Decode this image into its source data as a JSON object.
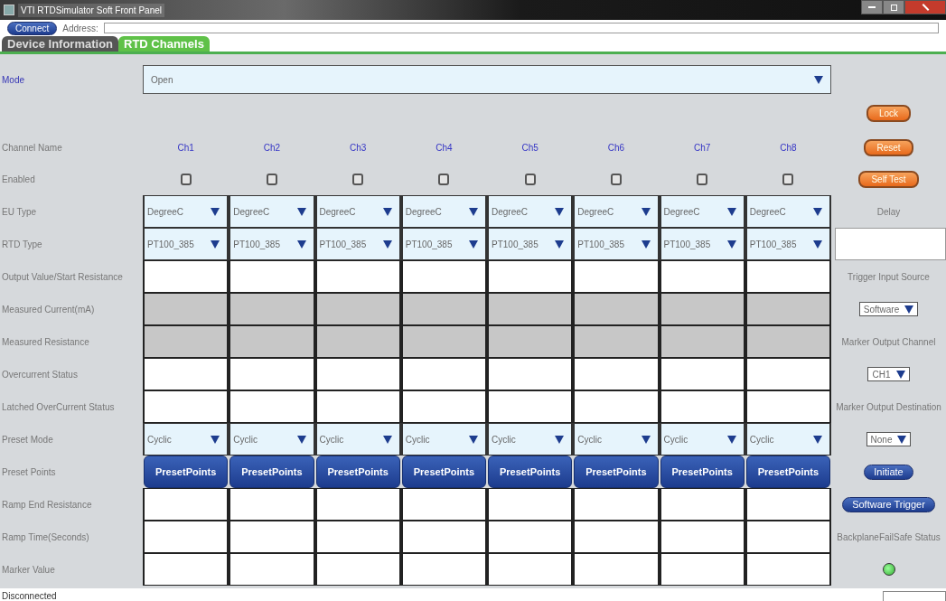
{
  "window": {
    "title": "VTI RTDSimulator Soft Front Panel"
  },
  "toolbar": {
    "connect_button": "Connect",
    "address_label": "Address:"
  },
  "tabs": [
    {
      "label": "Device Information",
      "selected": false
    },
    {
      "label": "RTD Channels",
      "selected": true
    }
  ],
  "mode": {
    "label": "Mode",
    "value": "Open"
  },
  "rows": [
    {
      "label": "Channel Name",
      "kind": "name",
      "cells": [
        "Ch1",
        "Ch2",
        "Ch3",
        "Ch4",
        "Ch5",
        "Ch6",
        "Ch7",
        "Ch8"
      ]
    },
    {
      "label": "Enabled",
      "kind": "checkbox",
      "cells": [
        {
          "checked": false
        },
        {
          "checked": false
        },
        {
          "checked": false
        },
        {
          "checked": false
        },
        {
          "checked": false
        },
        {
          "checked": false
        },
        {
          "checked": false
        },
        {
          "checked": false
        }
      ]
    },
    {
      "label": "EU Type",
      "kind": "select",
      "cells": [
        "DegreeC",
        "DegreeC",
        "DegreeC",
        "DegreeC",
        "DegreeC",
        "DegreeC",
        "DegreeC",
        "DegreeC"
      ]
    },
    {
      "label": "RTD Type",
      "kind": "select",
      "cells": [
        "PT100_385",
        "PT100_385",
        "PT100_385",
        "PT100_385",
        "PT100_385",
        "PT100_385",
        "PT100_385",
        "PT100_385"
      ]
    },
    {
      "label": "Output Value/Start Resistance",
      "kind": "input",
      "disabled": false
    },
    {
      "label": "Measured Current(mA)",
      "kind": "input",
      "disabled": true
    },
    {
      "label": "Measured Resistance",
      "kind": "input",
      "disabled": true
    },
    {
      "label": "Overcurrent Status",
      "kind": "input",
      "disabled": false
    },
    {
      "label": "Latched OverCurrent Status",
      "kind": "input",
      "disabled": false
    },
    {
      "label": "Preset Mode",
      "kind": "select",
      "cells": [
        "Cyclic",
        "Cyclic",
        "Cyclic",
        "Cyclic",
        "Cyclic",
        "Cyclic",
        "Cyclic",
        "Cyclic"
      ]
    },
    {
      "label": "Preset Points",
      "kind": "button",
      "cells": [
        "PresetPoints",
        "PresetPoints",
        "PresetPoints",
        "PresetPoints",
        "PresetPoints",
        "PresetPoints",
        "PresetPoints",
        "PresetPoints"
      ]
    },
    {
      "label": "Ramp End Resistance",
      "kind": "input",
      "disabled": false
    },
    {
      "label": "Ramp Time(Seconds)",
      "kind": "input",
      "disabled": false
    },
    {
      "label": "Marker Value",
      "kind": "input",
      "disabled": false
    }
  ],
  "side": [
    {
      "kind": "orange_button",
      "text": "Lock"
    },
    {
      "kind": "orange_button",
      "text": "Reset"
    },
    {
      "kind": "orange_button",
      "text": "Self Test"
    },
    {
      "kind": "label",
      "text": "Delay"
    },
    {
      "kind": "field"
    },
    {
      "kind": "label",
      "text": "Trigger Input Source"
    },
    {
      "kind": "select",
      "text": "Software"
    },
    {
      "kind": "label",
      "text": "Marker Output Channel"
    },
    {
      "kind": "select",
      "text": "CH1"
    },
    {
      "kind": "label",
      "text": "Marker Output Destination"
    },
    {
      "kind": "select",
      "text": "None"
    },
    {
      "kind": "blue_button",
      "text": "Initiate"
    },
    {
      "kind": "blue_button",
      "text": "Software Trigger"
    },
    {
      "kind": "label",
      "text": "BackplaneFailSafe Status"
    },
    {
      "kind": "led",
      "lit": true
    }
  ],
  "status_bar": {
    "text": "Disconnected"
  }
}
